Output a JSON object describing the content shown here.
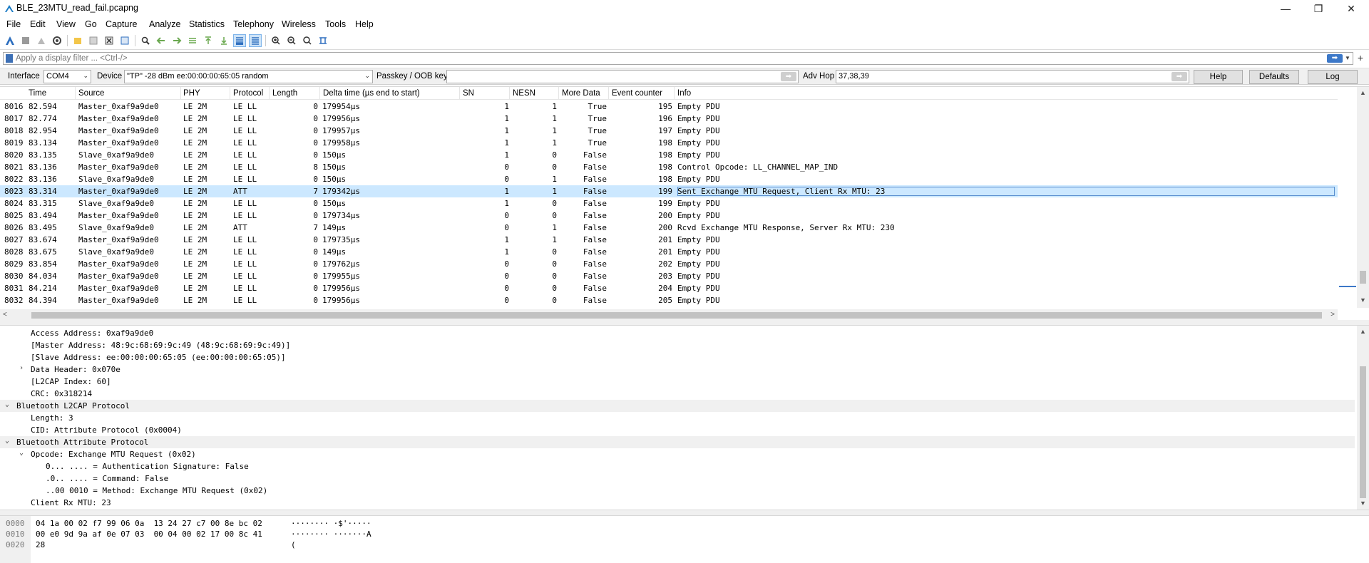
{
  "window": {
    "title": "BLE_23MTU_read_fail.pcapng",
    "controls": [
      "—",
      "❐",
      "✕"
    ]
  },
  "menu": [
    "File",
    "Edit",
    "View",
    "Go",
    "Capture",
    "Analyze",
    "Statistics",
    "Telephony",
    "Wireless",
    "Tools",
    "Help"
  ],
  "filter": {
    "placeholder": "Apply a display filter ... <Ctrl-/>",
    "apply_glyph": "➡",
    "add_glyph": "+"
  },
  "interface_bar": {
    "interface_label": "Interface",
    "interface_value": "COM4",
    "device_label": "Device",
    "device_value": "\"TP\" -28 dBm  ee:00:00:00:65:05  random",
    "passkey_label": "Passkey / OOB key",
    "passkey_value": "",
    "advhop_label": "Adv Hop",
    "advhop_value": "37,38,39",
    "help_label": "Help",
    "defaults_label": "Defaults",
    "log_label": "Log"
  },
  "packet_list": {
    "columns": [
      "Time",
      "Source",
      "PHY",
      "Protocol",
      "Length",
      "Delta time (µs end to start)",
      "SN",
      "NESN",
      "More Data",
      "Event counter",
      "Info"
    ],
    "selected_no": "8023",
    "rows": [
      {
        "no": "8016",
        "time": "82.594",
        "source": "Master_0xaf9a9de0",
        "phy": "LE 2M",
        "protocol": "LE LL",
        "length": "0",
        "delta": "179954µs",
        "sn": "1",
        "nesn": "1",
        "more": "True",
        "event": "195",
        "info": "Empty PDU"
      },
      {
        "no": "8017",
        "time": "82.774",
        "source": "Master_0xaf9a9de0",
        "phy": "LE 2M",
        "protocol": "LE LL",
        "length": "0",
        "delta": "179956µs",
        "sn": "1",
        "nesn": "1",
        "more": "True",
        "event": "196",
        "info": "Empty PDU"
      },
      {
        "no": "8018",
        "time": "82.954",
        "source": "Master_0xaf9a9de0",
        "phy": "LE 2M",
        "protocol": "LE LL",
        "length": "0",
        "delta": "179957µs",
        "sn": "1",
        "nesn": "1",
        "more": "True",
        "event": "197",
        "info": "Empty PDU"
      },
      {
        "no": "8019",
        "time": "83.134",
        "source": "Master_0xaf9a9de0",
        "phy": "LE 2M",
        "protocol": "LE LL",
        "length": "0",
        "delta": "179958µs",
        "sn": "1",
        "nesn": "1",
        "more": "True",
        "event": "198",
        "info": "Empty PDU"
      },
      {
        "no": "8020",
        "time": "83.135",
        "source": "Slave_0xaf9a9de0",
        "phy": "LE 2M",
        "protocol": "LE LL",
        "length": "0",
        "delta": "150µs",
        "sn": "1",
        "nesn": "0",
        "more": "False",
        "event": "198",
        "info": "Empty PDU"
      },
      {
        "no": "8021",
        "time": "83.136",
        "source": "Master_0xaf9a9de0",
        "phy": "LE 2M",
        "protocol": "LE LL",
        "length": "8",
        "delta": "150µs",
        "sn": "0",
        "nesn": "0",
        "more": "False",
        "event": "198",
        "info": "Control Opcode: LL_CHANNEL_MAP_IND"
      },
      {
        "no": "8022",
        "time": "83.136",
        "source": "Slave_0xaf9a9de0",
        "phy": "LE 2M",
        "protocol": "LE LL",
        "length": "0",
        "delta": "150µs",
        "sn": "0",
        "nesn": "1",
        "more": "False",
        "event": "198",
        "info": "Empty PDU"
      },
      {
        "no": "8023",
        "time": "83.314",
        "source": "Master_0xaf9a9de0",
        "phy": "LE 2M",
        "protocol": "ATT",
        "length": "7",
        "delta": "179342µs",
        "sn": "1",
        "nesn": "1",
        "more": "False",
        "event": "199",
        "info": "Sent Exchange MTU Request, Client Rx MTU: 23"
      },
      {
        "no": "8024",
        "time": "83.315",
        "source": "Slave_0xaf9a9de0",
        "phy": "LE 2M",
        "protocol": "LE LL",
        "length": "0",
        "delta": "150µs",
        "sn": "1",
        "nesn": "0",
        "more": "False",
        "event": "199",
        "info": "Empty PDU"
      },
      {
        "no": "8025",
        "time": "83.494",
        "source": "Master_0xaf9a9de0",
        "phy": "LE 2M",
        "protocol": "LE LL",
        "length": "0",
        "delta": "179734µs",
        "sn": "0",
        "nesn": "0",
        "more": "False",
        "event": "200",
        "info": "Empty PDU"
      },
      {
        "no": "8026",
        "time": "83.495",
        "source": "Slave_0xaf9a9de0",
        "phy": "LE 2M",
        "protocol": "ATT",
        "length": "7",
        "delta": "149µs",
        "sn": "0",
        "nesn": "1",
        "more": "False",
        "event": "200",
        "info": "Rcvd Exchange MTU Response, Server Rx MTU: 230"
      },
      {
        "no": "8027",
        "time": "83.674",
        "source": "Master_0xaf9a9de0",
        "phy": "LE 2M",
        "protocol": "LE LL",
        "length": "0",
        "delta": "179735µs",
        "sn": "1",
        "nesn": "1",
        "more": "False",
        "event": "201",
        "info": "Empty PDU"
      },
      {
        "no": "8028",
        "time": "83.675",
        "source": "Slave_0xaf9a9de0",
        "phy": "LE 2M",
        "protocol": "LE LL",
        "length": "0",
        "delta": "149µs",
        "sn": "1",
        "nesn": "0",
        "more": "False",
        "event": "201",
        "info": "Empty PDU"
      },
      {
        "no": "8029",
        "time": "83.854",
        "source": "Master_0xaf9a9de0",
        "phy": "LE 2M",
        "protocol": "LE LL",
        "length": "0",
        "delta": "179762µs",
        "sn": "0",
        "nesn": "0",
        "more": "False",
        "event": "202",
        "info": "Empty PDU"
      },
      {
        "no": "8030",
        "time": "84.034",
        "source": "Master_0xaf9a9de0",
        "phy": "LE 2M",
        "protocol": "LE LL",
        "length": "0",
        "delta": "179955µs",
        "sn": "0",
        "nesn": "0",
        "more": "False",
        "event": "203",
        "info": "Empty PDU"
      },
      {
        "no": "8031",
        "time": "84.214",
        "source": "Master_0xaf9a9de0",
        "phy": "LE 2M",
        "protocol": "LE LL",
        "length": "0",
        "delta": "179956µs",
        "sn": "0",
        "nesn": "0",
        "more": "False",
        "event": "204",
        "info": "Empty PDU"
      },
      {
        "no": "8032",
        "time": "84.394",
        "source": "Master_0xaf9a9de0",
        "phy": "LE 2M",
        "protocol": "LE LL",
        "length": "0",
        "delta": "179956µs",
        "sn": "0",
        "nesn": "0",
        "more": "False",
        "event": "205",
        "info": "Empty PDU"
      }
    ]
  },
  "packet_details": [
    {
      "indent": 1,
      "toggle": "",
      "text": "Access Address: 0xaf9a9de0",
      "section": false
    },
    {
      "indent": 1,
      "toggle": "",
      "text": "[Master Address: 48:9c:68:69:9c:49 (48:9c:68:69:9c:49)]",
      "section": false
    },
    {
      "indent": 1,
      "toggle": "",
      "text": "[Slave Address: ee:00:00:00:65:05 (ee:00:00:00:65:05)]",
      "section": false
    },
    {
      "indent": 1,
      "toggle": ">",
      "text": "Data Header: 0x070e",
      "section": false
    },
    {
      "indent": 1,
      "toggle": "",
      "text": "[L2CAP Index: 60]",
      "section": false
    },
    {
      "indent": 1,
      "toggle": "",
      "text": "CRC: 0x318214",
      "section": false
    },
    {
      "indent": 0,
      "toggle": "v",
      "text": "Bluetooth L2CAP Protocol",
      "section": true
    },
    {
      "indent": 1,
      "toggle": "",
      "text": "Length: 3",
      "section": false
    },
    {
      "indent": 1,
      "toggle": "",
      "text": "CID: Attribute Protocol (0x0004)",
      "section": false
    },
    {
      "indent": 0,
      "toggle": "v",
      "text": "Bluetooth Attribute Protocol",
      "section": true
    },
    {
      "indent": 1,
      "toggle": "v",
      "text": "Opcode: Exchange MTU Request (0x02)",
      "section": false
    },
    {
      "indent": 2,
      "toggle": "",
      "text": "0... .... = Authentication Signature: False",
      "section": false
    },
    {
      "indent": 2,
      "toggle": "",
      "text": ".0.. .... = Command: False",
      "section": false
    },
    {
      "indent": 2,
      "toggle": "",
      "text": "..00 0010 = Method: Exchange MTU Request (0x02)",
      "section": false
    },
    {
      "indent": 1,
      "toggle": "",
      "text": "Client Rx MTU: 23",
      "section": false
    }
  ],
  "packet_bytes": [
    {
      "offset": "0000",
      "hex": "04 1a 00 02 f7 99 06 0a  13 24 27 c7 00 8e bc 02",
      "ascii": "········ ·$'·····"
    },
    {
      "offset": "0010",
      "hex": "00 e0 9d 9a af 0e 07 03  00 04 00 02 17 00 8c 41",
      "ascii": "········ ·······A"
    },
    {
      "offset": "0020",
      "hex": "28",
      "ascii": "("
    }
  ]
}
